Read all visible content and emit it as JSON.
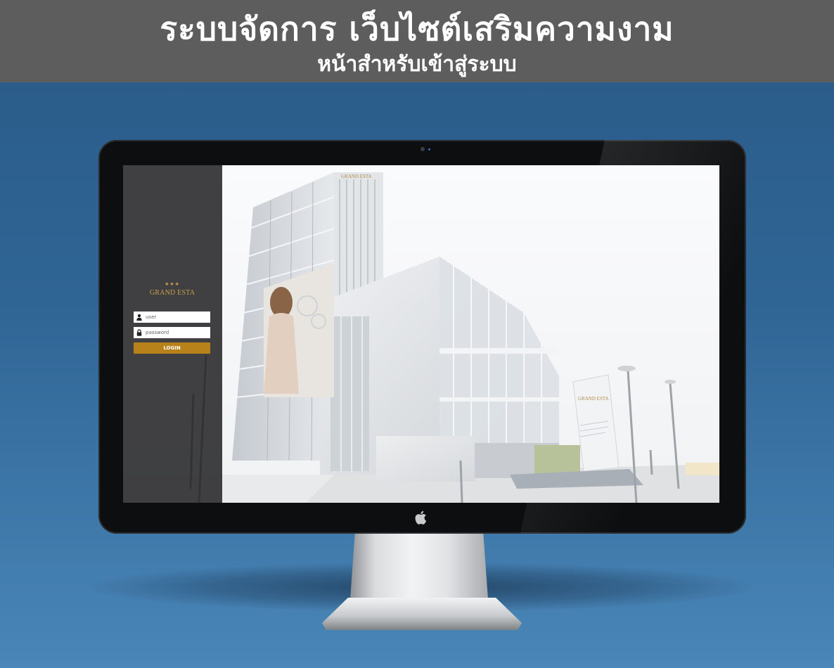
{
  "banner": {
    "title": "ระบบจัดการ เว็บไซต์เสริมความงาม",
    "subtitle": "หน้าสำหรับเข้าสู่ระบบ"
  },
  "login_page": {
    "brand": {
      "name": "GRAND ESTA",
      "stars": "★★★"
    },
    "username": {
      "placeholder": "user",
      "value": "",
      "icon": "user-icon"
    },
    "password": {
      "placeholder": "password",
      "value": "",
      "icon": "lock-icon"
    },
    "login_label": "LOGIN"
  },
  "background_signage": {
    "facade_sign": "GRAND ESTA",
    "pylon_sign": "GRAND ESTA"
  },
  "colors": {
    "banner_bg": "#5d5d5d",
    "page_bg": "#2f6595",
    "sidebar_bg": "#323234",
    "login_button": "#b8821a",
    "brand_gold": "#c8a04e"
  }
}
